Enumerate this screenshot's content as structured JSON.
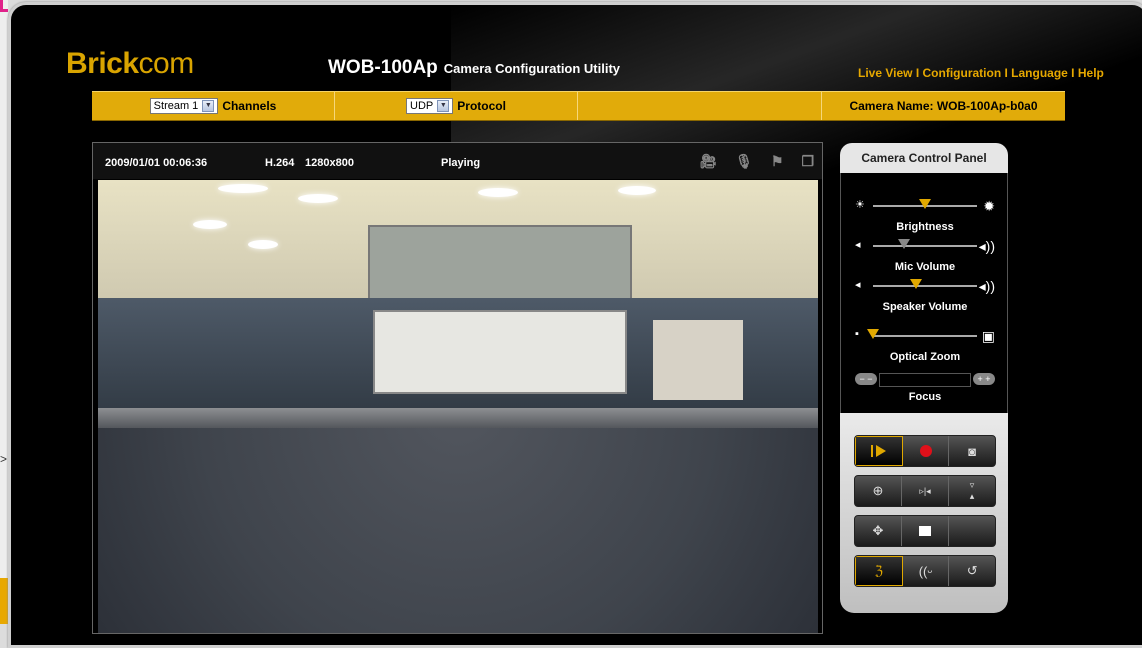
{
  "brand": {
    "bold": "Brick",
    "thin": "com"
  },
  "model": {
    "name": "WOB-100Ap",
    "subtitle": "Camera Configuration Utility"
  },
  "topnav": {
    "live_view": "Live View",
    "configuration": "Configuration",
    "language": "Language",
    "help": "Help",
    "separator": " I "
  },
  "toolbar": {
    "stream_value": "Stream 1",
    "channels_label": "Channels",
    "protocol_value": "UDP",
    "protocol_label": "Protocol",
    "camera_name": "Camera Name: WOB-100Ap-b0a0"
  },
  "video": {
    "timestamp": "2009/01/01  00:06:36",
    "codec": "H.264",
    "resolution": "1280x800",
    "status": "Playing"
  },
  "panel": {
    "title": "Camera Control Panel",
    "sliders": [
      {
        "label": "Brightness",
        "level": 0.5
      },
      {
        "label": "Mic Volume",
        "level": 0.3
      },
      {
        "label": "Speaker Volume",
        "level": 0.41
      },
      {
        "label": "Optical Zoom",
        "level": 0.0
      }
    ],
    "focus_label": "Focus"
  }
}
